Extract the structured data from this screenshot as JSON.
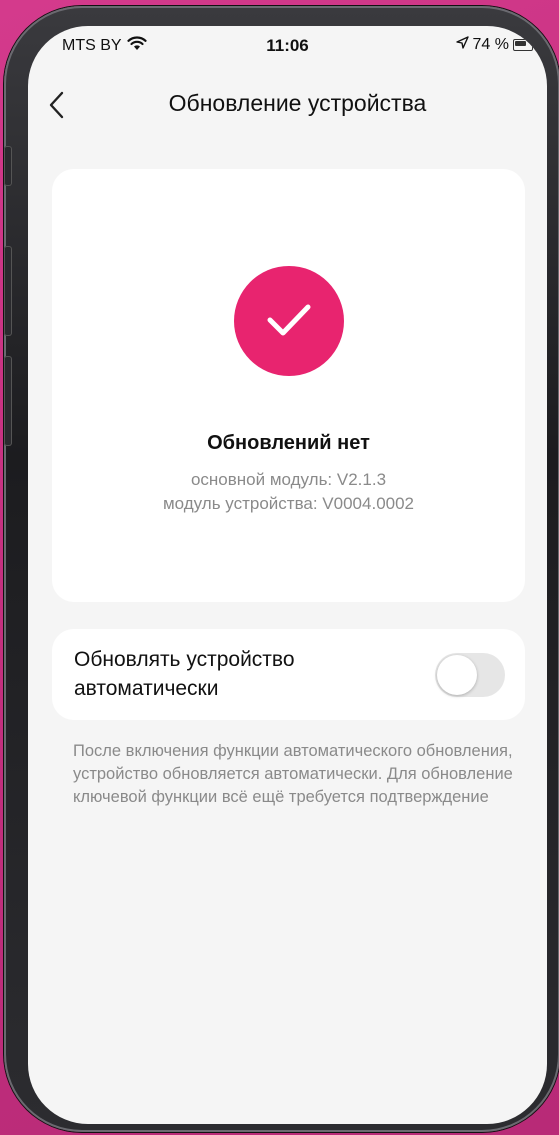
{
  "status_bar": {
    "carrier": "MTS BY",
    "time": "11:06",
    "battery_percent": "74 %",
    "icons": [
      "wifi-icon",
      "location-arrow-icon",
      "battery-icon"
    ]
  },
  "nav": {
    "back_icon": "chevron-left-icon",
    "title": "Обновление устройства"
  },
  "status_card": {
    "icon": "checkmark-icon",
    "accent_color": "#e8246f",
    "title": "Обновлений нет",
    "main_module": "основной модуль: V2.1.3",
    "device_module": "модуль устройства: V0004.0002"
  },
  "auto_update": {
    "label": "Обновлять устройство автоматически",
    "enabled": false
  },
  "description": "После включения функции автоматического обновления, устройство обновляется автоматически. Для обновление ключевой функции всё ещё требуется подтверждение"
}
